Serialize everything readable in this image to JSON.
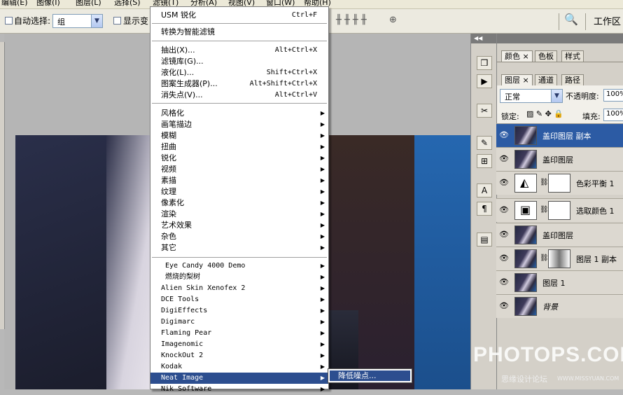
{
  "menubar": {
    "items": [
      "编辑(E)",
      "图像(I)",
      "图层(L)",
      "选择(S)",
      "滤镜(T)",
      "分析(A)",
      "视图(V)",
      "窗口(W)",
      "帮助(H)"
    ]
  },
  "options": {
    "auto_select_label": "自动选择:",
    "auto_select_value": "组",
    "show_transform_label": "显示变",
    "workspace_label": "工作区",
    "workspace_arrow": "▼"
  },
  "filter_menu": {
    "items_top": [
      {
        "label": "USM 锐化",
        "shortcut": "Ctrl+F"
      }
    ],
    "smart": {
      "label": "转换为智能滤镜"
    },
    "items_group2": [
      {
        "label": "抽出(X)...",
        "shortcut": "Alt+Ctrl+X"
      },
      {
        "label": "滤镜库(G)...",
        "shortcut": ""
      },
      {
        "label": "液化(L)...",
        "shortcut": "Shift+Ctrl+X"
      },
      {
        "label": "图案生成器(P)...",
        "shortcut": "Alt+Shift+Ctrl+X"
      },
      {
        "label": "消失点(V)...",
        "shortcut": "Alt+Ctrl+V"
      }
    ],
    "submenus": [
      "风格化",
      "画笔描边",
      "模糊",
      "扭曲",
      "锐化",
      "视频",
      "素描",
      "纹理",
      "像素化",
      "渲染",
      "艺术效果",
      "杂色",
      "其它"
    ],
    "plugins": [
      "Eye Candy 4000 Demo",
      "燃烧的梨树",
      "Alien Skin Xenofex 2",
      "DCE Tools",
      "DigiEffects",
      "Digimarc",
      "Flaming Pear",
      "Imagenomic",
      "KnockOut 2",
      "Kodak",
      "Neat Image",
      "Nik Software"
    ],
    "highlighted": "Neat Image",
    "submenu_item": "降低噪点..."
  },
  "panels": {
    "tabs_top": [
      "颜色",
      "色板",
      "样式"
    ],
    "tabs_layers": [
      "图层",
      "通道",
      "路径"
    ],
    "blend_mode": "正常",
    "opacity_label": "不透明度:",
    "opacity_value": "100%",
    "lock_label": "锁定:",
    "fill_label": "填充:",
    "fill_value": "100%",
    "layers": [
      {
        "name": "盖印图层 副本",
        "selected": true
      },
      {
        "name": "盖印图层"
      },
      {
        "name": "色彩平衡 1"
      },
      {
        "name": "选取颜色 1"
      },
      {
        "name": "盖印图层"
      },
      {
        "name": "图层 1 副本"
      },
      {
        "name": "图层 1"
      },
      {
        "name": "背景"
      }
    ]
  },
  "watermark": {
    "main": "PHOTOPS.COM",
    "sub": "思缘设计论坛",
    "url": "WWW.MISSYUAN.COM"
  },
  "colors": {
    "highlight": "#2c4e8f",
    "layer_selected": "#2c5ba4",
    "panel_bg": "#d4d0c8"
  }
}
